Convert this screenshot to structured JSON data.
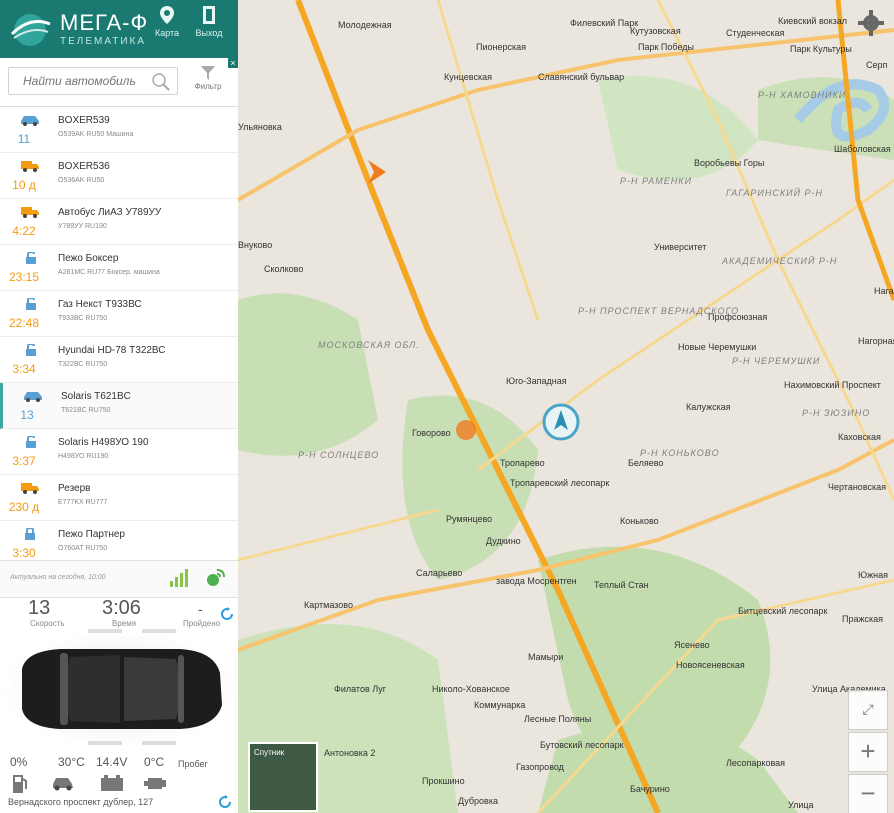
{
  "header": {
    "brand": "МЕГА-Ф",
    "brand_sub": "ТЕЛЕМАТИКА",
    "map_label": "Карта",
    "exit_label": "Выход"
  },
  "search": {
    "placeholder": "Найти автомобиль",
    "filter_label": "Фильтр"
  },
  "vehicles": [
    {
      "name": "BOXER539",
      "plate": "O539AK RU50",
      "note": "Машина",
      "time": "11",
      "icon": "car-icon",
      "color": "#5a9fd4"
    },
    {
      "name": "BOXER536",
      "plate": "O536AK RU50",
      "note": "",
      "time": "10 д",
      "icon": "truck-icon",
      "color": "#f39c12"
    },
    {
      "name": "Автобус ЛиАЗ У789УУ",
      "plate": "У789УУ RU190",
      "note": "",
      "time": "4:22",
      "icon": "truck-icon",
      "color": "#f39c12"
    },
    {
      "name": "Пежо Боксер",
      "plate": "A261MC RU77",
      "note": "Боксер. машина",
      "time": "23:15",
      "icon": "lock-open-icon",
      "color": "#f39c12"
    },
    {
      "name": "Газ Некст Т933ВС",
      "plate": "Т933ВС RU750",
      "note": "",
      "time": "22:48",
      "icon": "lock-open-icon",
      "color": "#f39c12"
    },
    {
      "name": "Hyundai HD-78 Т322ВС",
      "plate": "Т322ВС RU750",
      "note": "",
      "time": "3:34",
      "icon": "lock-open-icon",
      "color": "#f39c12"
    },
    {
      "name": "Solaris T621BC",
      "plate": "T621BC RU750",
      "note": "",
      "time": "13",
      "icon": "car-icon",
      "color": "#5a9fd4"
    },
    {
      "name": "Solaris H498УО 190",
      "plate": "H498УО RU190",
      "note": "",
      "time": "3:37",
      "icon": "lock-open-icon",
      "color": "#f39c12"
    },
    {
      "name": "Резерв",
      "plate": "E777KX RU777",
      "note": "",
      "time": "230 д",
      "icon": "truck-icon",
      "color": "#f39c12"
    },
    {
      "name": "Пежо Партнер",
      "plate": "O760AT RU750",
      "note": "",
      "time": "3:30",
      "icon": "lock-closed-icon",
      "color": "#f39c12"
    }
  ],
  "update_text": "Актуально на сегодня, 10:00",
  "stats": {
    "speed_value": "13",
    "speed_label": "Скорость",
    "time_value": "3:06",
    "time_label": "Время",
    "distance_value": "-",
    "distance_label": "Пройдено",
    "fuel": "0%",
    "engine_temp": "30°C",
    "voltage": "14.4V",
    "outside_temp": "0°C",
    "mileage_label": "Пробег",
    "address": "Вернадского проспект дублер, 127"
  },
  "map": {
    "labels": [
      "Молодежная",
      "Филевский Парк",
      "Кутузовская",
      "Студенческая",
      "Киевский вокзал",
      "Пионерская",
      "Парк Победы",
      "Парк Культуры",
      "Кунцевская",
      "Славянский бульвар",
      "Воробьевы Горы",
      "Университет",
      "Профсоюзная",
      "Новые Черемушки",
      "Калужская",
      "Нахимовский Проспект",
      "Каховская",
      "Юго-Западная",
      "Говорово",
      "Тропарево",
      "Беляево",
      "Коньково",
      "Тропаревский лесопарк",
      "Румянцево",
      "Дудкино",
      "Саларьево",
      "завода Мосрентген",
      "Теплый Стан",
      "Картмазово",
      "Ясенево",
      "Новоясеневская",
      "Битцевский лесопарк",
      "Пражская",
      "Чертановская",
      "Мамыри",
      "Филатов Луг",
      "Николо-Хованское",
      "Коммунарка",
      "Лесные Поляны",
      "Антоновка 2",
      "Бутовский лесопарк",
      "Газопровод",
      "Лесопарковая",
      "Улица Академика",
      "Прокшино",
      "Бачурино",
      "Дубровка",
      "Сколково",
      "Шаболовская",
      "Внуково",
      "Ульяновка",
      "Улица",
      "Южная",
      "Нагорная",
      "Нага",
      "Серп"
    ],
    "districts": [
      "Р-Н ХАМОВНИКИ",
      "Р-Н РАМЕНКИ",
      "ГАГАРИНСКИЙ Р-Н",
      "АКАДЕМИЧЕСКИЙ Р-Н",
      "Р-Н ПРОСПЕКТ ВЕРНАДСКОГО",
      "Р-Н ЧЕРЕМУШКИ",
      "Р-Н ЗЮЗИНО",
      "Р-Н КОНЬКОВО",
      "Р-Н СОЛНЦЕВО",
      "МОСКОВСКАЯ ОБЛ."
    ],
    "satellite_label": "Спутник",
    "zoom_in": "+",
    "zoom_out": "−"
  },
  "colors": {
    "accent": "#1a7a72",
    "orange": "#f39c12",
    "blue": "#5a9fd4",
    "road": "#f5a623"
  }
}
